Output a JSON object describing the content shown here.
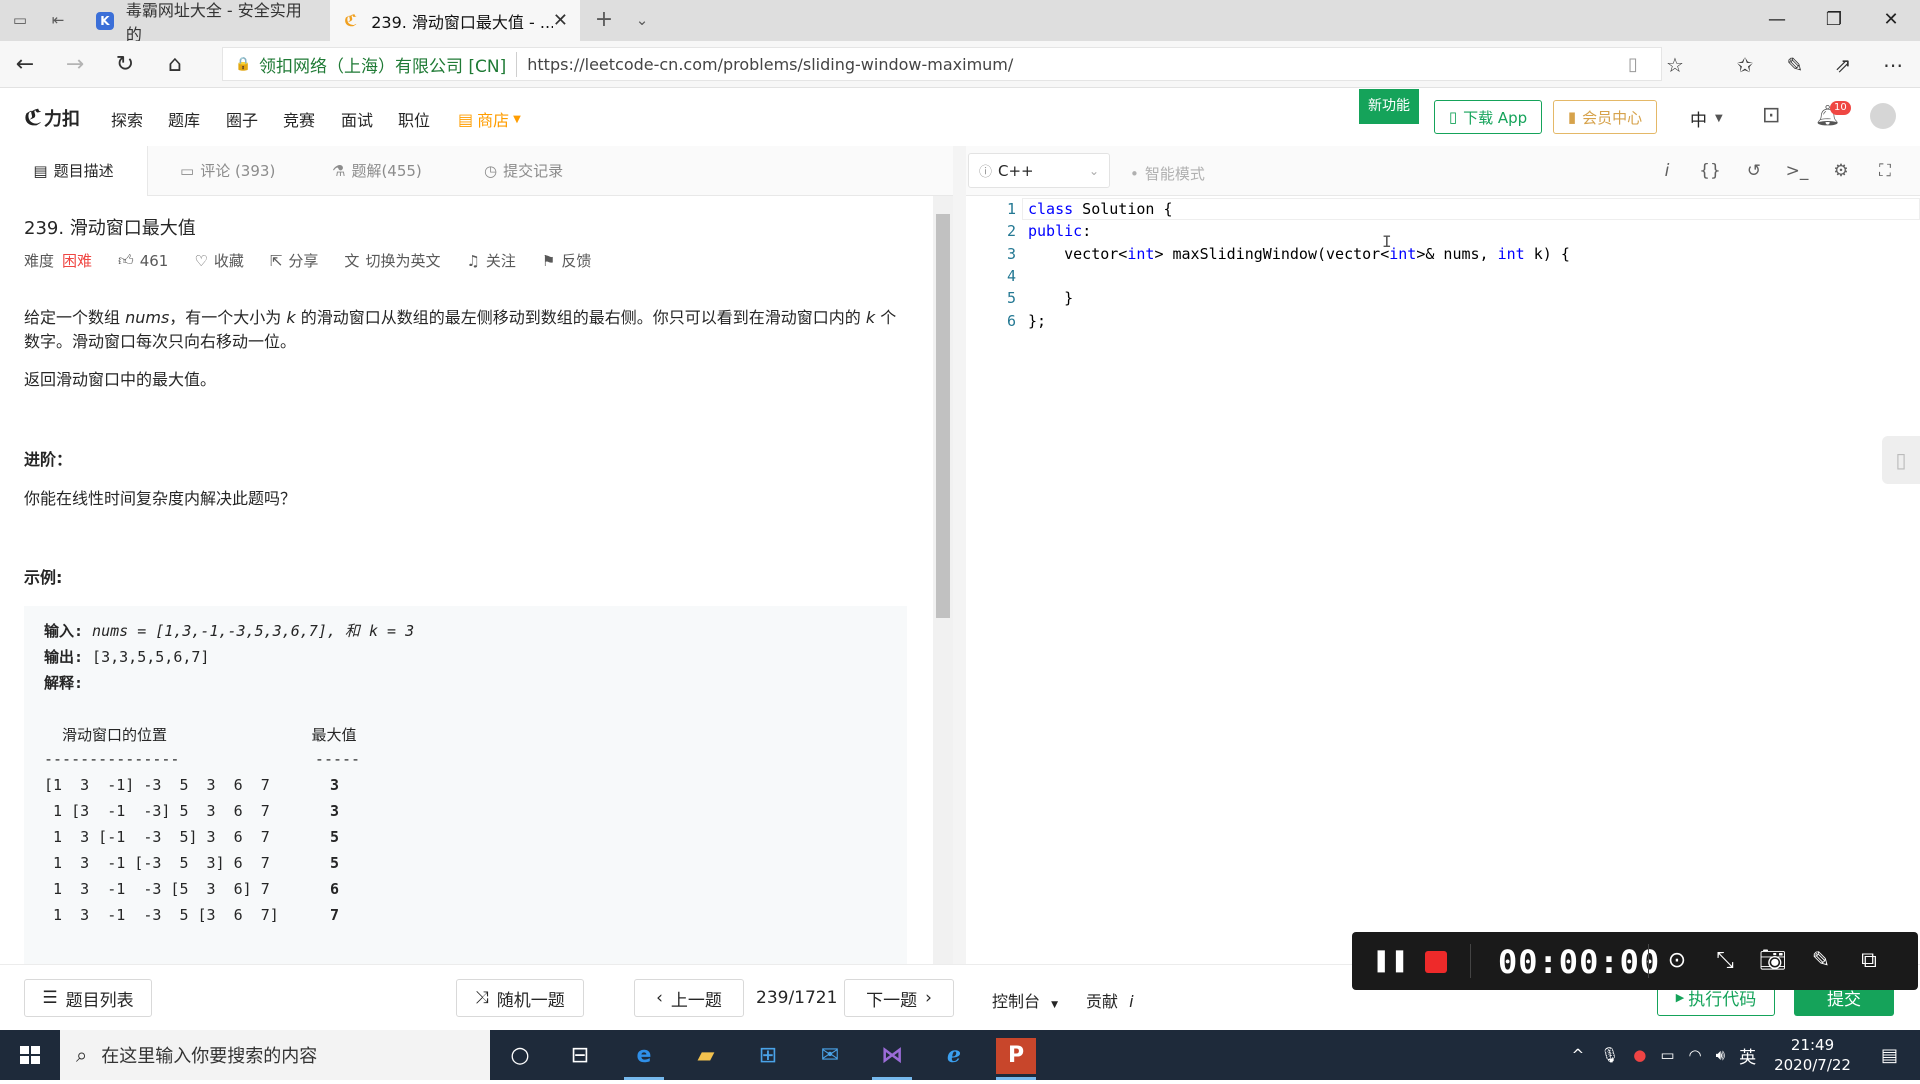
{
  "browser": {
    "tabs": [
      {
        "title": "毒霸网址大全 - 安全实用的",
        "favicon": "K",
        "favicon_color": "#3b6fd8",
        "active": false
      },
      {
        "title": "239. 滑动窗口最大值 - ...",
        "favicon": "lc-icon",
        "active": true
      }
    ],
    "cert_name": "领扣网络（上海）有限公司 [CN]",
    "url": "https://leetcode-cn.com/problems/sliding-window-maximum/"
  },
  "site_nav": {
    "logo": "力扣",
    "links": [
      "探索",
      "题库",
      "圈子",
      "竞赛",
      "面试",
      "职位"
    ],
    "store": "商店",
    "new_feature": "新功能",
    "download_app": "下载 App",
    "member_center": "会员中心",
    "lang": "中",
    "notification_count": "10"
  },
  "left_tabs": {
    "description": "题目描述",
    "comments": "评论 (393)",
    "solutions": "题解(455)",
    "submissions": "提交记录"
  },
  "problem": {
    "title": "239. 滑动窗口最大值",
    "difficulty_label": "难度",
    "difficulty": "困难",
    "likes": "461",
    "favorite": "收藏",
    "share": "分享",
    "switch_lang": "切换为英文",
    "follow": "关注",
    "feedback": "反馈",
    "para1_a": "给定一个数组 ",
    "para1_nums": "nums",
    "para1_b": "，有一个大小为 ",
    "para1_k": "k",
    "para1_c": " 的滑动窗口从数组的最左侧移动到数组的最右侧。你只可以看到在滑动窗口内的 ",
    "para1_k2": "k",
    "para1_d": " 个",
    "para1_line2": "数字。滑动窗口每次只向右移动一位。",
    "para2": "返回滑动窗口中的最大值。",
    "advanced_title": "进阶：",
    "advanced_text": "你能在线性时间复杂度内解决此题吗？",
    "example_title": "示例:",
    "example": {
      "input_label": "输入:",
      "input_value": " nums = [1,3,-1,-3,5,3,6,7], 和 k = 3",
      "output_label": "输出:",
      "output_value": " [3,3,5,5,6,7]",
      "explain_label": "解释:",
      "header": "  滑动窗口的位置                最大值",
      "divider": "---------------               -----",
      "rows": [
        {
          "window": "[1  3  -1] -3  5  3  6  7",
          "max": "3"
        },
        {
          "window": " 1 [3  -1  -3] 5  3  6  7",
          "max": "3"
        },
        {
          "window": " 1  3 [-1  -3  5] 3  6  7",
          "max": "5"
        },
        {
          "window": " 1  3  -1 [-3  5  3] 6  7",
          "max": "5"
        },
        {
          "window": " 1  3  -1  -3 [5  3  6] 7",
          "max": "6"
        },
        {
          "window": " 1  3  -1  -3  5 [3  6  7]",
          "max": "7"
        }
      ]
    }
  },
  "editor": {
    "language": "C++",
    "smart_mode": "智能模式",
    "lines": [
      {
        "n": "1",
        "text": "class Solution {"
      },
      {
        "n": "2",
        "text": "public:"
      },
      {
        "n": "3",
        "text": "    vector<int> maxSlidingWindow(vector<int>& nums, int k) {"
      },
      {
        "n": "4",
        "text": ""
      },
      {
        "n": "5",
        "text": "    }"
      },
      {
        "n": "6",
        "text": "};"
      }
    ]
  },
  "bottom": {
    "problem_list": "题目列表",
    "random": "随机一题",
    "prev": "上一题",
    "page": "239/1721",
    "next": "下一题",
    "console": "控制台",
    "contribute": "贡献",
    "run": "执行代码",
    "submit": "提交"
  },
  "recorder": {
    "time": "00:00:00"
  },
  "taskbar": {
    "search_placeholder": "在这里输入你要搜索的内容",
    "ime": "英",
    "time": "21:49",
    "date": "2020/7/22"
  },
  "colors": {
    "brand_green": "#15a35a",
    "hard_red": "#ef4743",
    "store_orange": "#ff9d00",
    "taskbar": "#1e2a3a"
  }
}
